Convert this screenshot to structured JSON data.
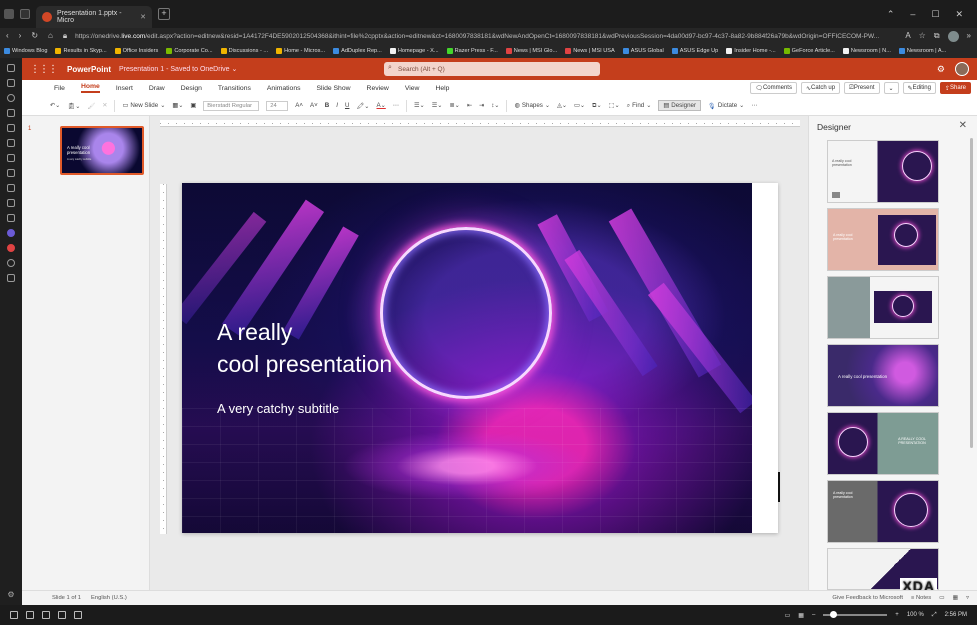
{
  "browser": {
    "tab_title": "Presentation 1.pptx - Micro",
    "new_tab": "+",
    "window_controls": [
      "⌃",
      "–",
      "☐",
      "✕"
    ],
    "url_prefix": "https://onedrive.",
    "url_domain": "live.com",
    "url_rest": "/edit.aspx?action=editnew&resid=1A4172F4DE5902012504368&ithint=file%2cpptx&action=editnew&ct=1680097838181&wdNewAndOpenCt=1680097838181&wdPreviousSession=4da00d97-bc97-4c37-8a82-9b884f26a79b&wdOrigin=OFFICECOM-PW..."
  },
  "bookmarks": [
    {
      "label": "Windows Blog",
      "color": "#3c8be0"
    },
    {
      "label": "Results in Skyp...",
      "color": "#f0b400"
    },
    {
      "label": "Office Insiders",
      "color": "#f0b400"
    },
    {
      "label": "Corporate Co...",
      "color": "#7cbb00"
    },
    {
      "label": "Discussions - ...",
      "color": "#f0b400"
    },
    {
      "label": "Home - Micros...",
      "color": "#f0b400"
    },
    {
      "label": "AdDuplex Rep...",
      "color": "#3c8be0"
    },
    {
      "label": "Homepage - X...",
      "color": "#f2f2f2"
    },
    {
      "label": "Razer Press - F...",
      "color": "#44d62c"
    },
    {
      "label": "News | MSI Glo...",
      "color": "#e04343"
    },
    {
      "label": "News | MSI USA",
      "color": "#e04343"
    },
    {
      "label": "ASUS Global",
      "color": "#3c8be0"
    },
    {
      "label": "ASUS Edge Up",
      "color": "#3c8be0"
    },
    {
      "label": "Insider Home -...",
      "color": "#f2f2f2"
    },
    {
      "label": "GeForce Article...",
      "color": "#76b900"
    },
    {
      "label": "Newsroom | N...",
      "color": "#f2f2f2"
    },
    {
      "label": "Newsroom | A...",
      "color": "#3c8be0"
    }
  ],
  "header": {
    "app_name": "PowerPoint",
    "doc_title": "Presentation 1 - Saved to OneDrive ⌄",
    "search_placeholder": "Search (Alt + Q)"
  },
  "menu": {
    "tabs": [
      "File",
      "Home",
      "Insert",
      "Draw",
      "Design",
      "Transitions",
      "Animations",
      "Slide Show",
      "Review",
      "View",
      "Help"
    ],
    "active_tab": "Home",
    "comments": "Comments",
    "catch_up": "Catch up",
    "present": "Present",
    "editing": "Editing",
    "share": "Share"
  },
  "ribbon": {
    "new_slide": "New Slide",
    "font_name": "Bierstadt Regular",
    "font_size": "24",
    "shapes": "Shapes",
    "find": "Find",
    "designer": "Designer",
    "dictate": "Dictate"
  },
  "thumbnails": {
    "slide_number": "1",
    "thumb_title": "A really cool presentation",
    "thumb_subtitle": "A very catchy subtitle"
  },
  "slide": {
    "title_line1": "A really",
    "title_line2": "cool presentation",
    "subtitle": "A very catchy subtitle"
  },
  "designer": {
    "title": "Designer",
    "close": "✕",
    "card1_text": "A really cool presentation",
    "card2_text": "A really cool presentation",
    "card4_text": "A really cool presentation",
    "card5_text": "A REALLY COOL PRESENTATION",
    "card6_text": "A really cool presentation"
  },
  "statusbar": {
    "slide_info": "Slide 1 of 1",
    "language": "English (U.S.)",
    "feedback": "Give Feedback to Microsoft",
    "notes": "Notes",
    "zoom": "100 %",
    "xda": "XDA"
  },
  "taskbar": {
    "time": "2:56 PM",
    "zoom_fraction": 0.1
  }
}
